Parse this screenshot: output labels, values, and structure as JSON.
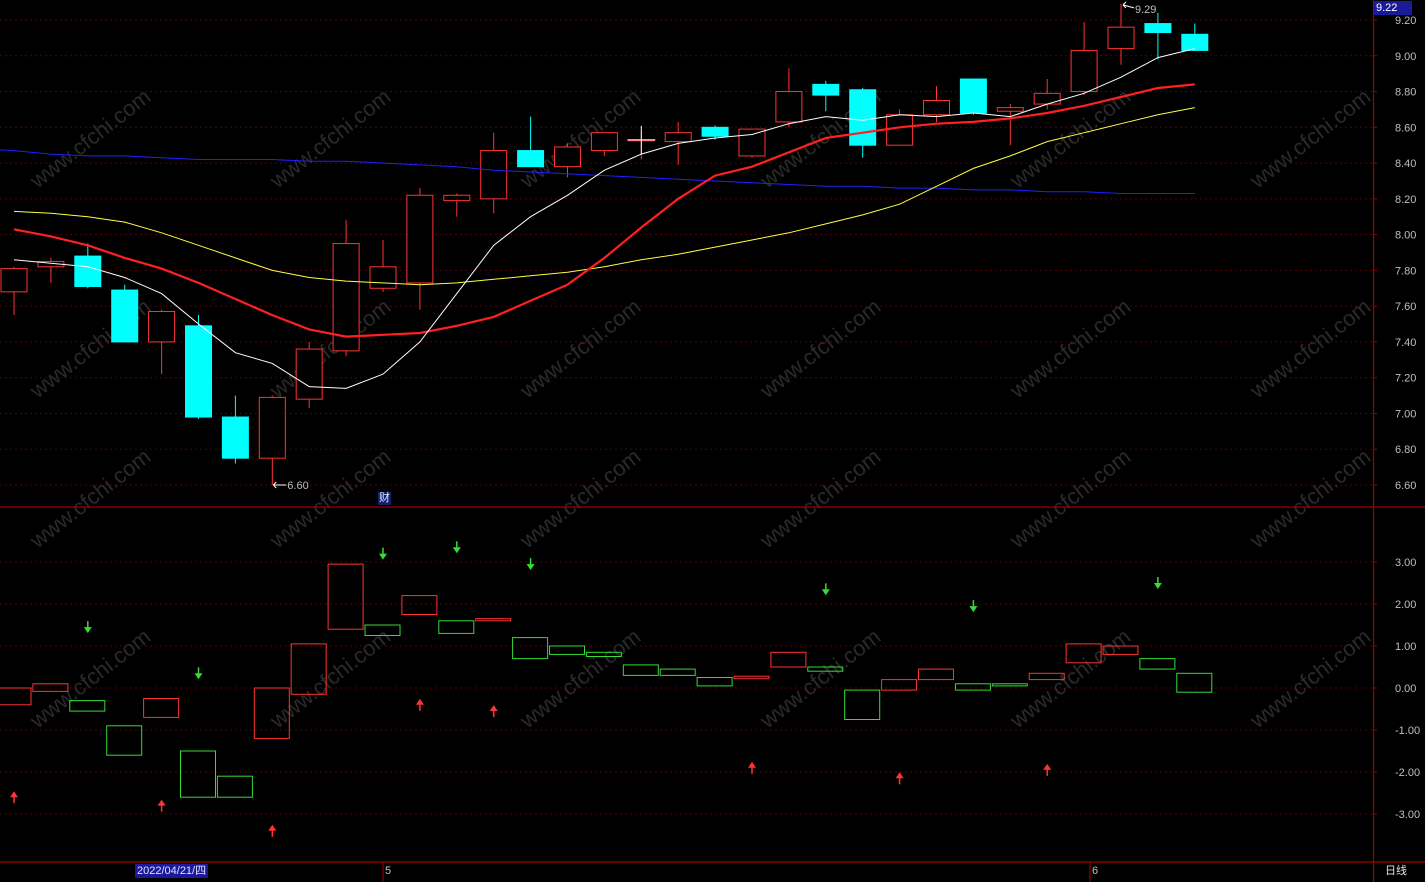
{
  "last_price_label": "9.22",
  "high_annotation": "9.29",
  "low_annotation": "6.60",
  "finance_marker": "财",
  "date_label": "2022/04/21/四",
  "month_labels": [
    "5",
    "6"
  ],
  "period_label": "日线",
  "watermark": "www.cfchi.com",
  "colors": {
    "background": "#000000",
    "up": "#ff3333",
    "down": "#00ffff",
    "ma5": "#ffffff",
    "ma10": "#ff2020",
    "ma20": "#ffff40",
    "ma60": "#2020ff",
    "grid": "#5a0000",
    "frame": "#a00000",
    "ind_up": "#ff3333",
    "ind_down": "#33dd33"
  },
  "chart_data": [
    {
      "type": "candlestick",
      "title": "",
      "y_ticks": [
        6.6,
        6.8,
        7.0,
        7.2,
        7.4,
        7.6,
        7.8,
        8.0,
        8.2,
        8.4,
        8.6,
        8.8,
        9.0,
        9.2
      ],
      "ylim": [
        6.45,
        9.3
      ],
      "grid": true,
      "ohlc": [
        [
          7.68,
          7.82,
          7.55,
          7.81
        ],
        [
          7.82,
          7.87,
          7.73,
          7.85
        ],
        [
          7.88,
          7.95,
          7.7,
          7.71
        ],
        [
          7.69,
          7.72,
          7.4,
          7.4
        ],
        [
          7.4,
          7.58,
          7.22,
          7.57
        ],
        [
          7.49,
          7.55,
          6.97,
          6.98
        ],
        [
          6.98,
          7.1,
          6.72,
          6.75
        ],
        [
          6.75,
          7.1,
          6.6,
          7.09
        ],
        [
          7.08,
          7.4,
          7.03,
          7.36
        ],
        [
          7.35,
          8.08,
          7.32,
          7.95
        ],
        [
          7.7,
          7.97,
          7.68,
          7.82
        ],
        [
          7.73,
          8.26,
          7.58,
          8.22
        ],
        [
          8.19,
          8.23,
          8.1,
          8.22
        ],
        [
          8.2,
          8.57,
          8.12,
          8.47
        ],
        [
          8.47,
          8.66,
          8.38,
          8.38
        ],
        [
          8.38,
          8.51,
          8.32,
          8.49
        ],
        [
          8.47,
          8.57,
          8.44,
          8.57
        ],
        [
          8.53,
          8.58,
          8.42,
          8.53
        ],
        [
          8.52,
          8.63,
          8.39,
          8.57
        ],
        [
          8.6,
          8.61,
          8.53,
          8.55
        ],
        [
          8.44,
          8.59,
          8.43,
          8.59
        ],
        [
          8.63,
          8.93,
          8.6,
          8.8
        ],
        [
          8.84,
          8.86,
          8.69,
          8.78
        ],
        [
          8.81,
          8.82,
          8.43,
          8.5
        ],
        [
          8.5,
          8.7,
          8.5,
          8.67
        ],
        [
          8.67,
          8.83,
          8.63,
          8.75
        ],
        [
          8.87,
          8.87,
          8.67,
          8.68
        ],
        [
          8.69,
          8.73,
          8.5,
          8.71
        ],
        [
          8.73,
          8.87,
          8.7,
          8.79
        ],
        [
          8.8,
          9.19,
          8.78,
          9.03
        ],
        [
          9.04,
          9.29,
          8.95,
          9.16
        ],
        [
          9.18,
          9.24,
          8.98,
          9.13
        ],
        [
          9.12,
          9.18,
          9.03,
          9.03
        ]
      ],
      "ma5": [
        7.86,
        7.84,
        7.82,
        7.76,
        7.67,
        7.5,
        7.34,
        7.28,
        7.15,
        7.14,
        7.22,
        7.4,
        7.67,
        7.94,
        8.1,
        8.22,
        8.36,
        8.45,
        8.51,
        8.54,
        8.56,
        8.62,
        8.66,
        8.64,
        8.67,
        8.66,
        8.68,
        8.66,
        8.73,
        8.79,
        8.88,
        8.99,
        9.04
      ],
      "ma10": [
        8.03,
        7.99,
        7.94,
        7.87,
        7.81,
        7.73,
        7.64,
        7.55,
        7.47,
        7.43,
        7.44,
        7.45,
        7.49,
        7.54,
        7.63,
        7.72,
        7.87,
        8.04,
        8.2,
        8.33,
        8.38,
        8.46,
        8.54,
        8.57,
        8.6,
        8.62,
        8.63,
        8.65,
        8.68,
        8.72,
        8.77,
        8.82,
        8.84
      ],
      "ma20": [
        8.13,
        8.12,
        8.1,
        8.07,
        8.01,
        7.94,
        7.87,
        7.8,
        7.76,
        7.74,
        7.73,
        7.72,
        7.73,
        7.75,
        7.77,
        7.79,
        7.82,
        7.86,
        7.89,
        7.93,
        7.97,
        8.01,
        8.06,
        8.11,
        8.17,
        8.27,
        8.37,
        8.44,
        8.52,
        8.57,
        8.62,
        8.67,
        8.71
      ],
      "ma60": [
        8.55,
        8.53,
        8.52,
        8.51,
        8.49,
        8.48,
        8.47,
        8.45,
        8.44,
        8.44,
        8.43,
        8.42,
        8.42,
        8.42,
        8.41,
        8.41,
        8.4,
        8.39,
        8.38,
        8.36,
        8.35,
        8.34,
        8.33,
        8.32,
        8.31,
        8.3,
        8.29,
        8.28,
        8.27,
        8.27,
        8.26,
        8.26,
        8.25,
        8.25,
        8.24,
        8.24,
        8.23,
        8.23,
        8.23
      ],
      "ma60_start_index": -6
    },
    {
      "type": "bar",
      "title": "",
      "y_ticks": [
        -3.0,
        -2.0,
        -1.0,
        0.0,
        1.0,
        2.0,
        3.0
      ],
      "y_tick_labels": [
        "-3.00",
        "-2.00",
        "-1.00",
        "0.00",
        "1.00",
        "2.00",
        "3.00"
      ],
      "ylim": [
        -4.1,
        4.0
      ],
      "grid": true,
      "boxes": [
        [
          0.0,
          -0.4,
          "up"
        ],
        [
          0.1,
          -0.08,
          "up"
        ],
        [
          -0.3,
          -0.55,
          "down"
        ],
        [
          -0.9,
          -1.6,
          "down"
        ],
        [
          -0.25,
          -0.7,
          "up"
        ],
        [
          -1.5,
          -2.6,
          "down"
        ],
        [
          -2.1,
          -2.6,
          "down"
        ],
        [
          0.0,
          -1.2,
          "up"
        ],
        [
          1.05,
          -0.15,
          "up"
        ],
        [
          2.95,
          1.4,
          "up"
        ],
        [
          1.5,
          1.25,
          "down"
        ],
        [
          2.2,
          1.75,
          "up"
        ],
        [
          1.6,
          1.3,
          "down"
        ],
        [
          1.65,
          1.6,
          "up"
        ],
        [
          1.2,
          0.7,
          "down"
        ],
        [
          1.0,
          0.8,
          "down"
        ],
        [
          0.85,
          0.75,
          "down"
        ],
        [
          0.55,
          0.3,
          "down"
        ],
        [
          0.45,
          0.3,
          "down"
        ],
        [
          0.25,
          0.05,
          "down"
        ],
        [
          0.28,
          0.22,
          "up"
        ],
        [
          0.85,
          0.5,
          "up"
        ],
        [
          0.5,
          0.4,
          "down"
        ],
        [
          -0.05,
          -0.75,
          "down"
        ],
        [
          0.2,
          -0.05,
          "up"
        ],
        [
          0.45,
          0.2,
          "up"
        ],
        [
          0.1,
          -0.05,
          "down"
        ],
        [
          0.1,
          0.05,
          "down"
        ],
        [
          0.35,
          0.2,
          "up"
        ],
        [
          1.05,
          0.6,
          "up"
        ],
        [
          1.0,
          0.8,
          "up"
        ],
        [
          0.7,
          0.45,
          "down"
        ],
        [
          0.35,
          -0.1,
          "down"
        ]
      ],
      "arrows": [
        [
          0,
          -2.6,
          "up"
        ],
        [
          2,
          1.45,
          "down"
        ],
        [
          4,
          -2.8,
          "up"
        ],
        [
          5,
          0.35,
          "down"
        ],
        [
          7,
          -3.4,
          "up"
        ],
        [
          10,
          3.2,
          "down"
        ],
        [
          11,
          -0.4,
          "up"
        ],
        [
          12,
          3.35,
          "down"
        ],
        [
          13,
          -0.55,
          "up"
        ],
        [
          14,
          2.95,
          "down"
        ],
        [
          20,
          -1.9,
          "up"
        ],
        [
          22,
          2.35,
          "down"
        ],
        [
          24,
          -2.15,
          "up"
        ],
        [
          26,
          1.95,
          "down"
        ],
        [
          28,
          -1.95,
          "up"
        ],
        [
          31,
          2.5,
          "down"
        ]
      ]
    }
  ]
}
